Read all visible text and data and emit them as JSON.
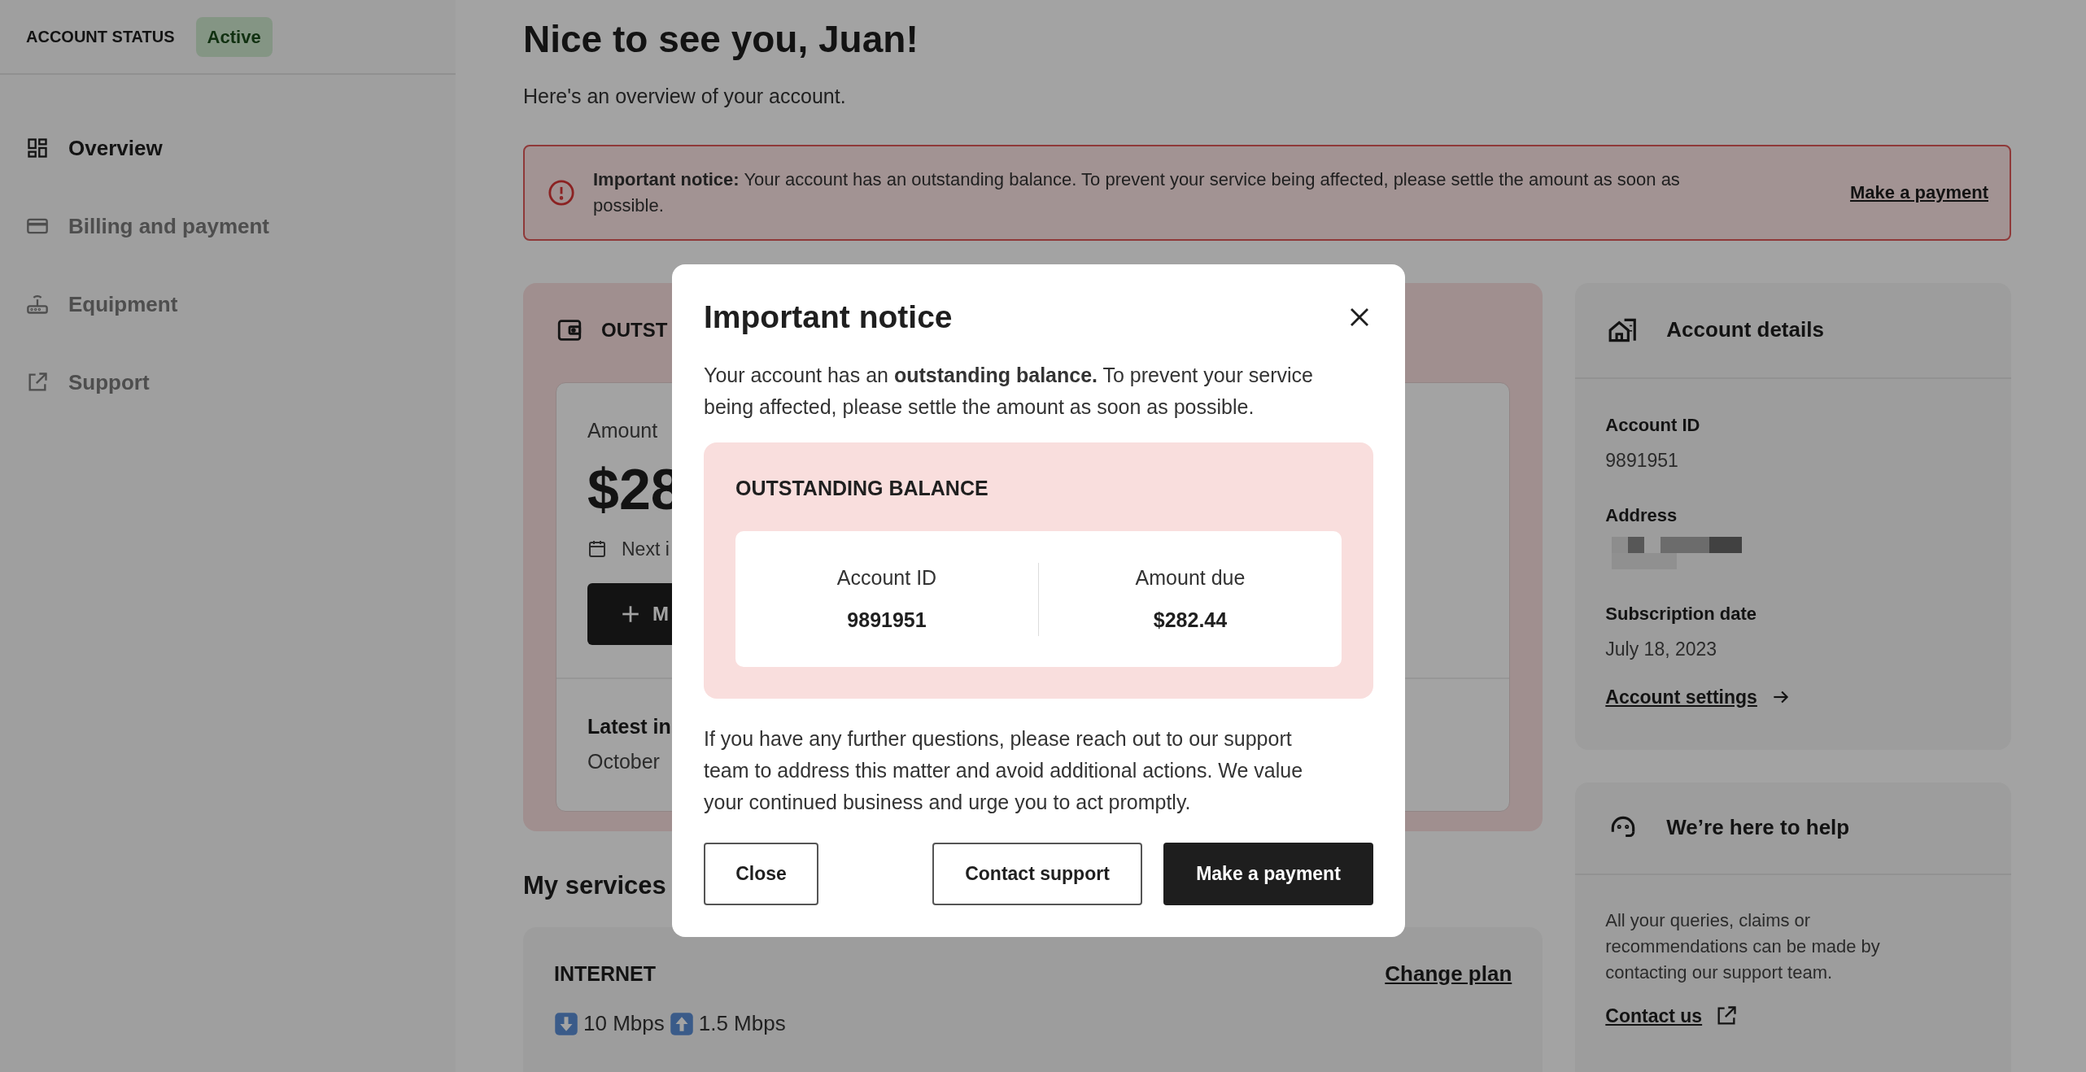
{
  "sidebar": {
    "status_label": "ACCOUNT STATUS",
    "status_badge": "Active",
    "items": [
      {
        "label": "Overview",
        "selected": true
      },
      {
        "label": "Billing and payment",
        "selected": false
      },
      {
        "label": "Equipment",
        "selected": false
      },
      {
        "label": "Support",
        "selected": false
      }
    ]
  },
  "header": {
    "title": "Nice to see you, Juan!",
    "subtitle": "Here's an overview of your account."
  },
  "notice_banner": {
    "text": "**Important notice:** Your account has an outstanding balance. To prevent your service being affected, please settle the amount as soon as possible.",
    "link": "Make a payment"
  },
  "balance_card": {
    "title": "OUTST",
    "amount_label": "Amount",
    "amount": "$28",
    "next_invoice": "Next i",
    "button": "M",
    "latest_label": "Latest in",
    "latest_value": "October"
  },
  "services": {
    "title": "My services",
    "internet": {
      "title": "INTERNET",
      "link": "Change plan",
      "download": "10 Mbps",
      "upload": "1.5 Mbps"
    }
  },
  "account_details": {
    "title": "Account details",
    "fields": [
      {
        "label": "Account ID",
        "value": "9891951"
      },
      {
        "label": "Address",
        "kind": "redacted"
      },
      {
        "label": "Subscription date",
        "value": "July 18, 2023"
      }
    ],
    "link": "Account settings"
  },
  "help": {
    "title": "We’re here to help",
    "text": "All your queries, claims or recommendations can be made by contacting our support team.",
    "link": "Contact us"
  },
  "modal": {
    "title": "Important notice",
    "text": "Your account has an **outstanding balance.** To prevent your service being affected, please settle the amount as soon as possible.",
    "balance_title": "OUTSTANDING BALANCE",
    "columns": [
      {
        "label": "Account ID",
        "value": "9891951"
      },
      {
        "label": "Amount due",
        "value": "$282.44"
      }
    ],
    "footer_text": "If you have any further questions, please reach out to our support team to address this matter and avoid additional actions. We value your continued business and urge you to act promptly.",
    "buttons": [
      {
        "label": "Close",
        "kind": "outline"
      },
      {
        "label": "Contact support",
        "kind": "outline"
      },
      {
        "label": "Make a payment",
        "kind": "primary"
      }
    ]
  }
}
